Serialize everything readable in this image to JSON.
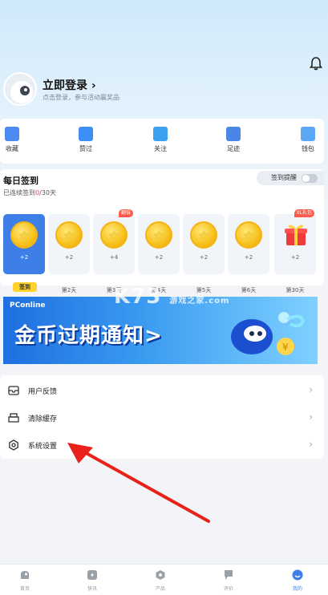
{
  "header": {
    "notification_icon": "bell-icon"
  },
  "profile": {
    "login_title": "立即登录",
    "login_subtitle": "点击登录，参与活动赢奖品"
  },
  "quick_actions": [
    {
      "label": "收藏",
      "icon": "collect-icon"
    },
    {
      "label": "赞过",
      "icon": "like-icon"
    },
    {
      "label": "关注",
      "icon": "follow-icon"
    },
    {
      "label": "足迹",
      "icon": "footprint-icon"
    },
    {
      "label": "钱包",
      "icon": "wallet-icon"
    }
  ],
  "checkin": {
    "title": "每日签到",
    "subtitle_prefix": "已连续签到",
    "subtitle_count": "0",
    "subtitle_suffix": "/30天",
    "remind_label": "签到提醒",
    "days": [
      {
        "amount": "+2",
        "label": "签到",
        "active": true
      },
      {
        "amount": "+2",
        "label": "第2天"
      },
      {
        "amount": "+4",
        "label": "第3天",
        "tag": "翻倍"
      },
      {
        "amount": "+2",
        "label": "第4天"
      },
      {
        "amount": "+2",
        "label": "第5天"
      },
      {
        "amount": "+2",
        "label": "第6天"
      },
      {
        "amount": "+2",
        "label": "第30天",
        "tag": "XL礼包"
      }
    ]
  },
  "banner": {
    "brand": "PConline",
    "headline": "金币过期通知>"
  },
  "watermark": {
    "text": "K73",
    "sub": "游戏之家",
    "domain": ".com"
  },
  "menu": [
    {
      "label": "用户反馈",
      "icon": "feedback-icon"
    },
    {
      "label": "清除缓存",
      "icon": "clear-cache-icon"
    },
    {
      "label": "系统设置",
      "icon": "settings-icon"
    }
  ],
  "tabs": [
    {
      "label": "首页",
      "icon": "home-icon"
    },
    {
      "label": "快讯",
      "icon": "flash-icon"
    },
    {
      "label": "产品",
      "icon": "product-icon"
    },
    {
      "label": "评价",
      "icon": "review-icon"
    },
    {
      "label": "我的",
      "icon": "profile-icon",
      "active": true
    }
  ],
  "colors": {
    "accent": "#3d7fe6",
    "highlight": "#f0503c",
    "sign_button": "#ffd22e"
  }
}
